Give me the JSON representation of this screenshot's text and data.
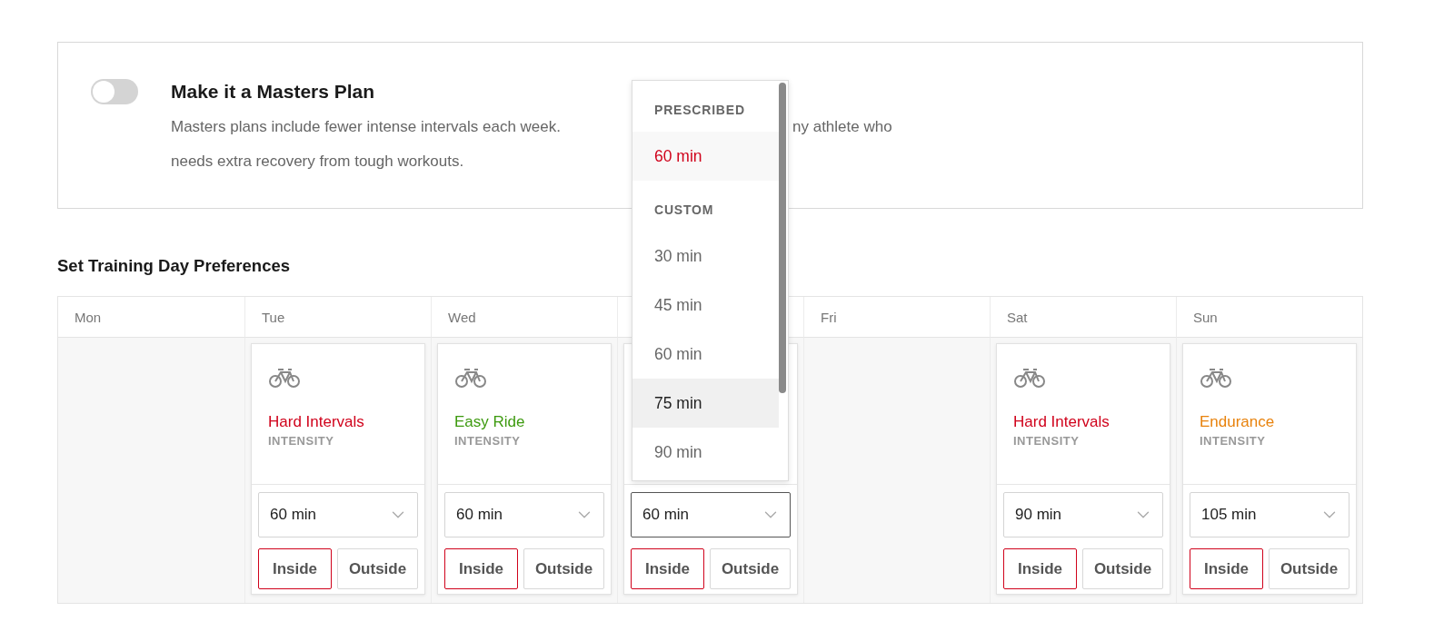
{
  "masters": {
    "on": false,
    "title": "Make it a Masters Plan",
    "description_line1_left": "Masters plans include fewer intense intervals each week.",
    "description_line1_right": "ny athlete who",
    "description_line2": "needs extra recovery from tough workouts."
  },
  "section_title": "Set Training Day Preferences",
  "days": [
    {
      "label": "Mon",
      "kind": "empty"
    },
    {
      "label": "Tue",
      "kind": "workout",
      "workout": "Hard Intervals",
      "color": "#d0021b",
      "intensity": "INTENSITY",
      "duration": "60 min",
      "focused": false,
      "locations": [
        {
          "label": "Inside",
          "selected": true
        },
        {
          "label": "Outside",
          "selected": false
        }
      ]
    },
    {
      "label": "Wed",
      "kind": "workout",
      "workout": "Easy Ride",
      "color": "#3d9a0f",
      "intensity": "INTENSITY",
      "duration": "60 min",
      "focused": false,
      "locations": [
        {
          "label": "Inside",
          "selected": true
        },
        {
          "label": "Outside",
          "selected": false
        }
      ]
    },
    {
      "kind": "covered",
      "duration": "60 min",
      "focused": true,
      "locations": [
        {
          "label": "Inside",
          "selected": true
        },
        {
          "label": "Outside",
          "selected": false
        }
      ]
    },
    {
      "label": "Fri",
      "kind": "empty"
    },
    {
      "label": "Sat",
      "kind": "workout",
      "workout": "Hard Intervals",
      "color": "#d0021b",
      "intensity": "INTENSITY",
      "duration": "90 min",
      "focused": false,
      "locations": [
        {
          "label": "Inside",
          "selected": true
        },
        {
          "label": "Outside",
          "selected": false
        }
      ]
    },
    {
      "label": "Sun",
      "kind": "workout",
      "workout": "Endurance",
      "color": "#e8820c",
      "intensity": "INTENSITY",
      "duration": "105 min",
      "focused": false,
      "locations": [
        {
          "label": "Inside",
          "selected": true
        },
        {
          "label": "Outside",
          "selected": false
        }
      ]
    }
  ],
  "duration_menu": [
    {
      "kind": "group",
      "label": "PRESCRIBED"
    },
    {
      "kind": "option",
      "label": "60 min",
      "selected": true,
      "hovered": false
    },
    {
      "kind": "group",
      "label": "CUSTOM"
    },
    {
      "kind": "option",
      "label": "30 min",
      "selected": false,
      "hovered": false
    },
    {
      "kind": "option",
      "label": "45 min",
      "selected": false,
      "hovered": false
    },
    {
      "kind": "option",
      "label": "60 min",
      "selected": false,
      "hovered": false
    },
    {
      "kind": "option",
      "label": "75 min",
      "selected": false,
      "hovered": true
    },
    {
      "kind": "option",
      "label": "90 min",
      "selected": false,
      "hovered": false
    }
  ]
}
